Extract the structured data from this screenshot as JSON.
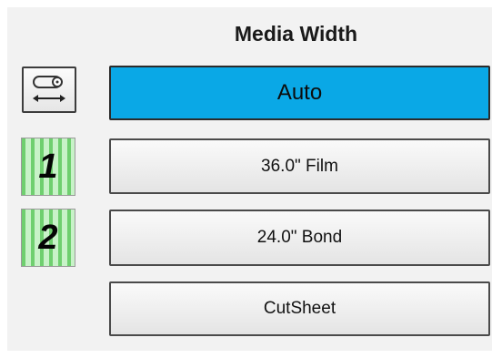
{
  "panel": {
    "title": "Media Width"
  },
  "icons": {
    "media_width_icon": "roll-width-icon",
    "roll1_icon": "roll-1-icon",
    "roll2_icon": "roll-2-icon"
  },
  "roll1": {
    "number": "1"
  },
  "roll2": {
    "number": "2"
  },
  "buttons": {
    "auto": "Auto",
    "film": "36.0\" Film",
    "bond": "24.0\" Bond",
    "cutsheet": "CutSheet"
  },
  "colors": {
    "selected": "#0aa8e6",
    "roll_green": "#6fcf6f",
    "roll_light": "#c8f2c8"
  }
}
